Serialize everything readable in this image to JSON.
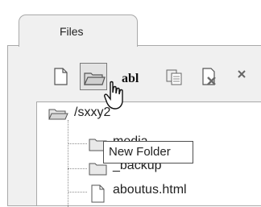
{
  "tab": {
    "label": "Files"
  },
  "toolbar": {
    "buttons": [
      {
        "icon": "new-file-icon"
      },
      {
        "icon": "new-folder-icon"
      },
      {
        "icon": "rename-icon",
        "label": "abl"
      },
      {
        "icon": "copy-icon"
      },
      {
        "icon": "delete-icon"
      }
    ]
  },
  "tooltip": {
    "text": "New Folder"
  },
  "tree": {
    "root": "/sxxy2",
    "items": [
      "media",
      "_backup",
      "aboutus.html"
    ]
  }
}
